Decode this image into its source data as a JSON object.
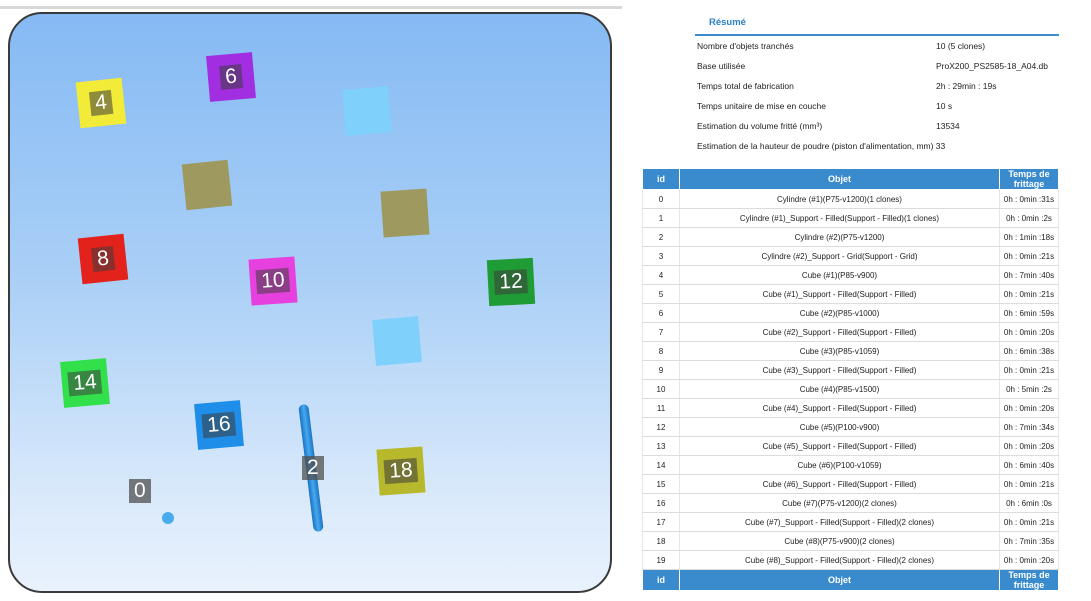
{
  "plate": {
    "parts": [
      {
        "label": "0",
        "color": "#6a6a6a"
      },
      {
        "label": "2",
        "color": "#6a6a6a"
      },
      {
        "label": "4",
        "color": "#f2ec38"
      },
      {
        "label": "6",
        "color": "#a12ee0"
      },
      {
        "label": "8",
        "color": "#e3221c"
      },
      {
        "label": "10",
        "color": "#e640de"
      },
      {
        "label": "12",
        "color": "#1f9c35"
      },
      {
        "label": "14",
        "color": "#31e04a"
      },
      {
        "label": "16",
        "color": "#1e8ee8"
      },
      {
        "label": "18",
        "color": "#b7b82b"
      }
    ]
  },
  "resume": {
    "title": "Résumé",
    "rows": [
      {
        "key": "Nombre d'objets tranchés",
        "value": "10 (5 clones)"
      },
      {
        "key": "Base utilisée",
        "value": "ProX200_PS2585-18_A04.db"
      },
      {
        "key": "Temps total de fabrication",
        "value": "2h : 29min : 19s"
      },
      {
        "key": "Temps unitaire de mise en couche",
        "value": "10 s"
      },
      {
        "key": "Estimation du volume fritté (mm³)",
        "value": "13534"
      },
      {
        "key": "Estimation de la hauteur de poudre (piston d'alimentation, mm) 33",
        "value": ""
      }
    ]
  },
  "table": {
    "headers": [
      "id",
      "Objet",
      "Temps de frittage"
    ],
    "rows": [
      [
        "0",
        "Cylindre (#1)(P75-v1200)(1 clones)",
        "0h : 0min :31s"
      ],
      [
        "1",
        "Cylindre (#1)_Support - Filled(Support - Filled)(1 clones)",
        "0h : 0min :2s"
      ],
      [
        "2",
        "Cylindre (#2)(P75-v1200)",
        "0h : 1min :18s"
      ],
      [
        "3",
        "Cylindre (#2)_Support - Grid(Support - Grid)",
        "0h : 0min :21s"
      ],
      [
        "4",
        "Cube (#1)(P85-v900)",
        "0h : 7min :40s"
      ],
      [
        "5",
        "Cube (#1)_Support - Filled(Support - Filled)",
        "0h : 0min :21s"
      ],
      [
        "6",
        "Cube (#2)(P85-v1000)",
        "0h : 6min :59s"
      ],
      [
        "7",
        "Cube (#2)_Support - Filled(Support - Filled)",
        "0h : 0min :20s"
      ],
      [
        "8",
        "Cube (#3)(P85-v1059)",
        "0h : 6min :38s"
      ],
      [
        "9",
        "Cube (#3)_Support - Filled(Support - Filled)",
        "0h : 0min :21s"
      ],
      [
        "10",
        "Cube (#4)(P85-v1500)",
        "0h : 5min :2s"
      ],
      [
        "11",
        "Cube (#4)_Support - Filled(Support - Filled)",
        "0h : 0min :20s"
      ],
      [
        "12",
        "Cube (#5)(P100-v900)",
        "0h : 7min :34s"
      ],
      [
        "13",
        "Cube (#5)_Support - Filled(Support - Filled)",
        "0h : 0min :20s"
      ],
      [
        "14",
        "Cube (#6)(P100-v1059)",
        "0h : 6min :40s"
      ],
      [
        "15",
        "Cube (#6)_Support - Filled(Support - Filled)",
        "0h : 0min :21s"
      ],
      [
        "16",
        "Cube (#7)(P75-v1200)(2 clones)",
        "0h : 6min :0s"
      ],
      [
        "17",
        "Cube (#7)_Support - Filled(Support - Filled)(2 clones)",
        "0h : 0min :21s"
      ],
      [
        "18",
        "Cube (#8)(P75-v900)(2 clones)",
        "0h : 7min :35s"
      ],
      [
        "19",
        "Cube (#8)_Support - Filled(Support - Filled)(2 clones)",
        "0h : 0min :20s"
      ]
    ]
  }
}
